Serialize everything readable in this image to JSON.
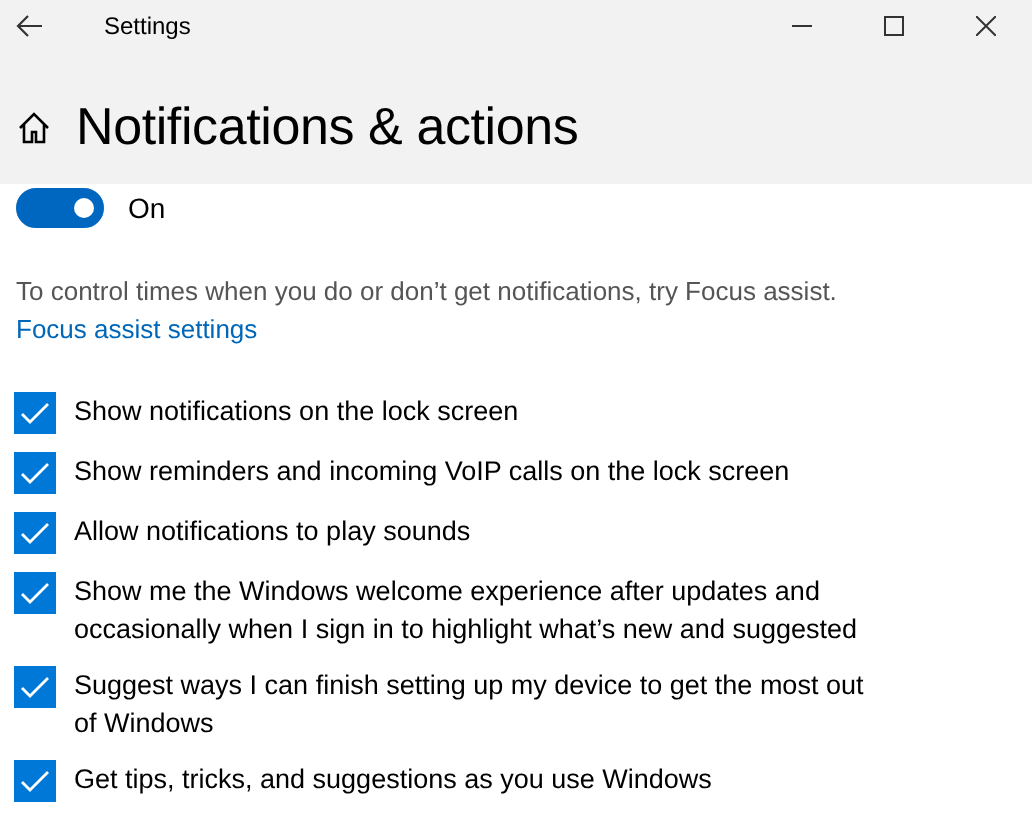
{
  "window": {
    "title": "Settings"
  },
  "page": {
    "title": "Notifications & actions"
  },
  "toggle": {
    "on": true,
    "label": "On"
  },
  "description": "To control times when you do or don’t get notifications, try Focus assist.",
  "link": "Focus assist settings",
  "options": [
    {
      "label": "Show notifications on the lock screen",
      "checked": true
    },
    {
      "label": "Show reminders and incoming VoIP calls on the lock screen",
      "checked": true
    },
    {
      "label": "Allow notifications to play sounds",
      "checked": true
    },
    {
      "label": "Show me the Windows welcome experience after updates and occasionally when I sign in to highlight what’s new and suggested",
      "checked": true
    },
    {
      "label": "Suggest ways I can finish setting up my device to get the most out of Windows",
      "checked": true
    },
    {
      "label": "Get tips, tricks, and suggestions as you use Windows",
      "checked": true
    }
  ]
}
